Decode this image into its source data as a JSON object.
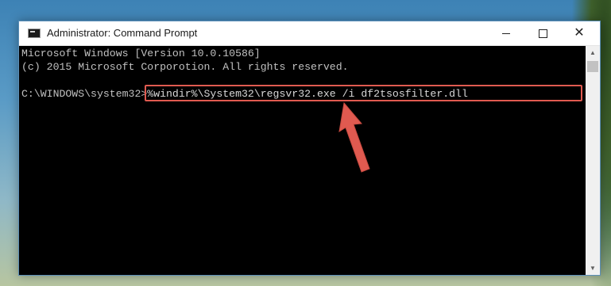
{
  "window": {
    "title": "Administrator: Command Prompt",
    "controls": {
      "minimize": "—",
      "maximize": "□",
      "close": "✕"
    }
  },
  "console": {
    "lines": [
      "Microsoft Windows [Version 10.0.10586]",
      "(c) 2015 Microsoft Corporotion. All rights reserved."
    ],
    "prompt": "C:\\WINDOWS\\system32>",
    "command": "%windir%\\System32\\regsvr32.exe /i df2tsosfilter.dll"
  },
  "annotations": {
    "highlight_color": "#e05a50",
    "arrow_color": "#e05a50"
  },
  "icons": {
    "app": "command-prompt-icon",
    "scroll_up": "chevron-up-icon",
    "scroll_down": "chevron-down-icon"
  }
}
